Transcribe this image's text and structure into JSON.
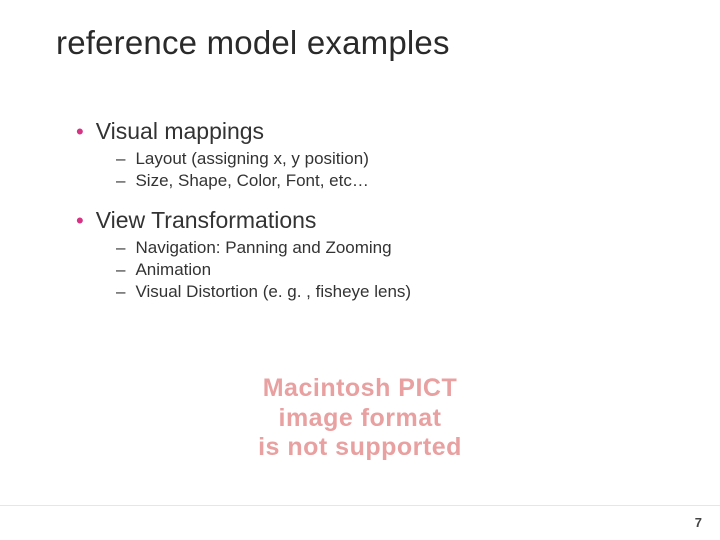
{
  "title": "reference model examples",
  "bullets": [
    {
      "label": "Visual mappings",
      "children": [
        "Layout (assigning x, y position)",
        "Size, Shape, Color, Font, etc…"
      ]
    },
    {
      "label": "View Transformations",
      "children": [
        "Navigation: Panning and Zooming",
        "Animation",
        "Visual Distortion (e. g. , fisheye lens)"
      ]
    }
  ],
  "watermark": {
    "line1": "Macintosh PICT",
    "line2": "image format",
    "line3": "is not supported"
  },
  "page_number": "7"
}
